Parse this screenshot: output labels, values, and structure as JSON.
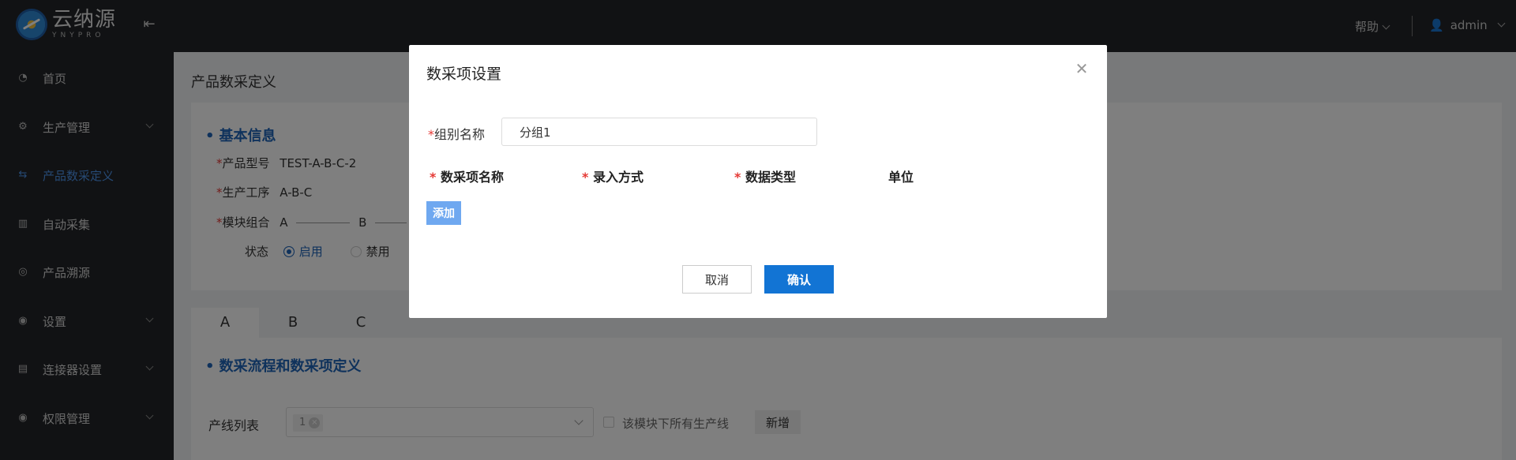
{
  "app": {
    "logo_cn": "云纳源",
    "logo_en": "YNYPRO"
  },
  "header": {
    "help_label": "帮助",
    "user_label": "admin"
  },
  "sidebar": {
    "items": [
      {
        "label": "首页",
        "icon": "dashboard-icon"
      },
      {
        "label": "生产管理",
        "icon": "gear-icon"
      },
      {
        "label": "产品数采定义",
        "icon": "link-icon"
      },
      {
        "label": "自动采集",
        "icon": "book-icon"
      },
      {
        "label": "产品溯源",
        "icon": "trace-icon"
      },
      {
        "label": "设置",
        "icon": "settings-icon"
      },
      {
        "label": "连接器设置",
        "icon": "film-icon"
      },
      {
        "label": "权限管理",
        "icon": "shield-icon"
      }
    ]
  },
  "page": {
    "title": "产品数采定义",
    "basic_info_title": "基本信息",
    "model_label": "产品型号",
    "model_value": "TEST-A-B-C-2",
    "process_label": "生产工序",
    "process_value": "A-B-C",
    "module_label": "模块组合",
    "module_a": "A",
    "module_b": "B",
    "status_label": "状态",
    "status_enabled": "启用",
    "status_disabled": "禁用",
    "tabs": [
      "A",
      "B",
      "C"
    ],
    "flow_title": "数采流程和数采项定义",
    "line_list_label": "产线列表",
    "line_tag": "1",
    "all_lines_label": "该模块下所有生产线",
    "new_button": "新增"
  },
  "modal": {
    "title": "数采项设置",
    "group_name_label": "组别名称",
    "group_name_value": "分组1",
    "columns": [
      "数采项名称",
      "录入方式",
      "数据类型",
      "单位"
    ],
    "add_button": "添加",
    "cancel_button": "取消",
    "confirm_button": "确认"
  },
  "colors": {
    "accent": "#1274d4",
    "sidebar_bg": "#232528",
    "active_nav": "#4c93e8"
  }
}
